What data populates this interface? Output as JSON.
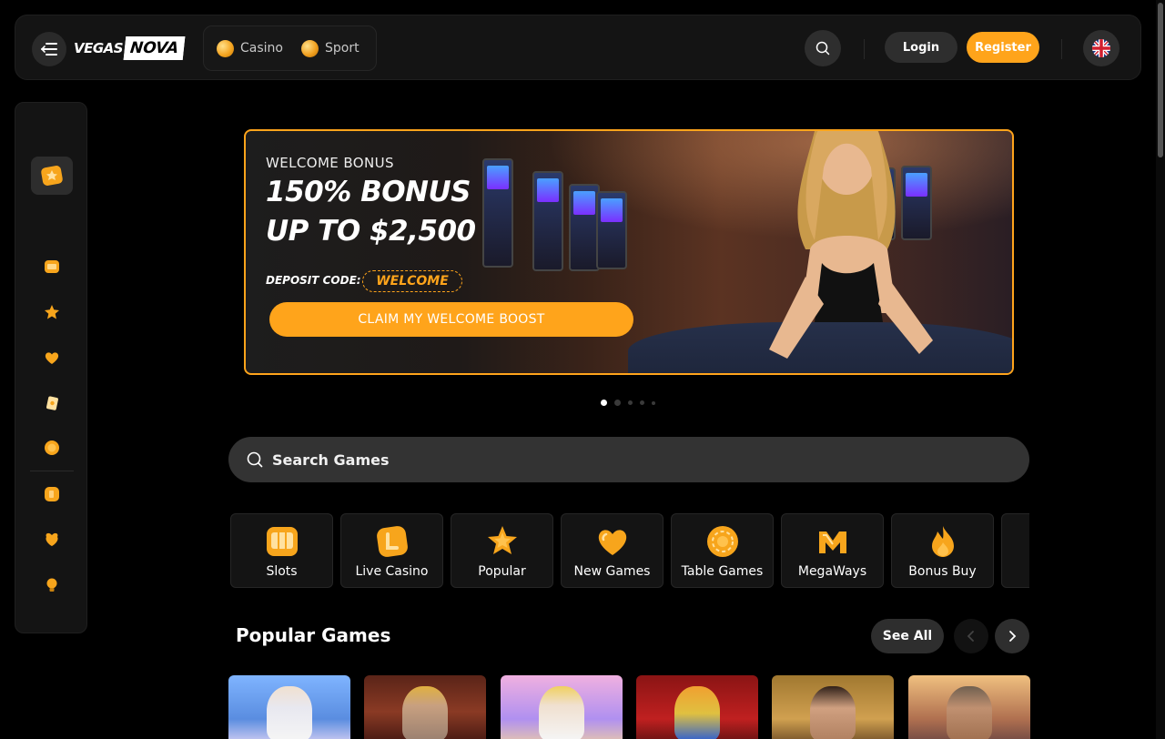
{
  "header": {
    "logo_text_1": "VEGAS",
    "logo_text_2": "NOVA",
    "modes": [
      {
        "label": "Casino",
        "icon": "coin-icon"
      },
      {
        "label": "Sport",
        "icon": "ball-icon"
      }
    ],
    "login_label": "Login",
    "register_label": "Register",
    "language_icon": "uk-flag-icon"
  },
  "sidebar": {
    "items": [
      {
        "icon": "promo-icon"
      },
      {
        "icon": "slots-icon"
      },
      {
        "icon": "star-icon"
      },
      {
        "icon": "heart-icon"
      },
      {
        "icon": "card-icon"
      },
      {
        "icon": "chip-icon"
      },
      {
        "icon": "live-icon"
      },
      {
        "icon": "bonus-icon"
      },
      {
        "icon": "bulb-icon"
      }
    ]
  },
  "banner": {
    "label": "WELCOME BONUS",
    "title_line1": "150% BONUS",
    "title_line2": "UP TO $2,500",
    "deposit_label": "DEPOSIT CODE:",
    "deposit_code": "WELCOME",
    "cta_label": "CLAIM MY WELCOME BOOST",
    "slides_total": 5,
    "active_slide": 1
  },
  "search": {
    "placeholder": "Search Games"
  },
  "categories": [
    {
      "label": "Slots",
      "icon": "slots-icon"
    },
    {
      "label": "Live Casino",
      "icon": "live-casino-icon"
    },
    {
      "label": "Popular",
      "icon": "star-icon"
    },
    {
      "label": "New Games",
      "icon": "heart-icon"
    },
    {
      "label": "Table Games",
      "icon": "chip-icon"
    },
    {
      "label": "MegaWays",
      "icon": "megaways-icon"
    },
    {
      "label": "Bonus Buy",
      "icon": "fire-icon"
    }
  ],
  "popular_games": {
    "title": "Popular Games",
    "see_all_label": "See All"
  },
  "colors": {
    "accent": "#ffa41b",
    "background": "#000000",
    "panel": "#141414",
    "button": "#2e2e2e"
  }
}
